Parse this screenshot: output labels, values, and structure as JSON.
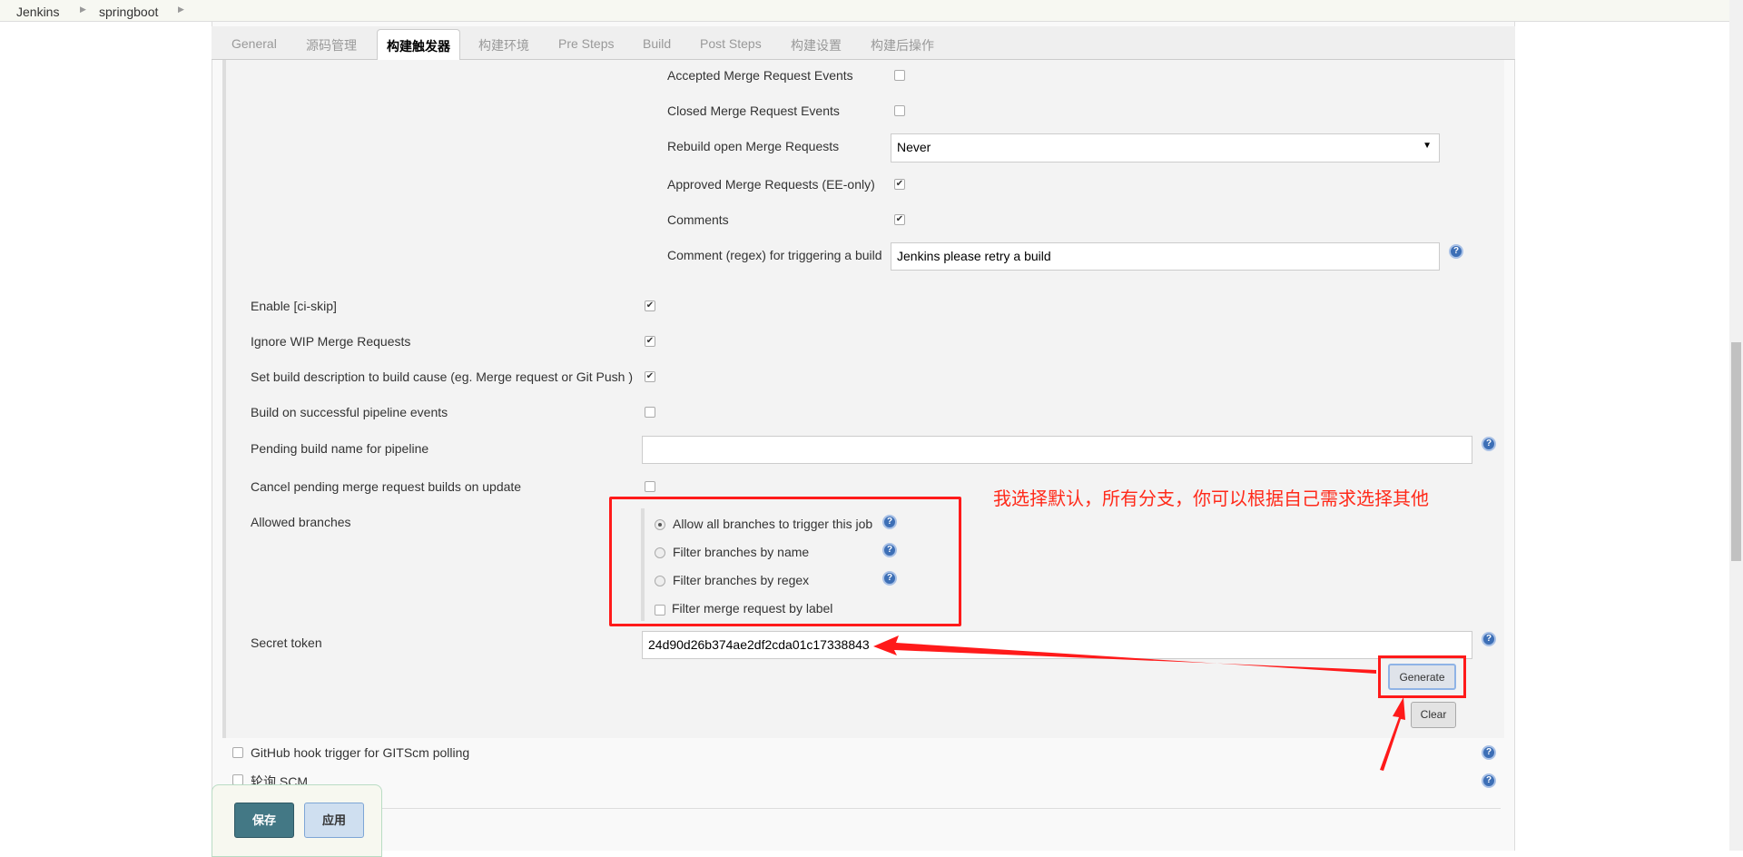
{
  "breadcrumb": [
    "Jenkins",
    "springboot"
  ],
  "tabs": [
    "General",
    "源码管理",
    "构建触发器",
    "构建环境",
    "Pre Steps",
    "Build",
    "Post Steps",
    "构建设置",
    "构建后操作"
  ],
  "active_tab": "构建触发器",
  "nested": {
    "accepted": {
      "label": "Accepted Merge Request Events",
      "checked": false
    },
    "closed": {
      "label": "Closed Merge Request Events",
      "checked": false
    },
    "rebuild": {
      "label": "Rebuild open Merge Requests",
      "value": "Never"
    },
    "approved": {
      "label": "Approved Merge Requests (EE-only)",
      "checked": true
    },
    "comments": {
      "label": "Comments",
      "checked": true
    },
    "comment_regex": {
      "label": "Comment (regex) for triggering a build",
      "value": "Jenkins please retry a build"
    }
  },
  "options": {
    "ci_skip": {
      "label": "Enable [ci-skip]",
      "checked": true
    },
    "wip": {
      "label": "Ignore WIP Merge Requests",
      "checked": true
    },
    "set_desc": {
      "label": "Set build description to build cause (eg. Merge request or Git Push )",
      "checked": true
    },
    "pipeline": {
      "label": "Build on successful pipeline events",
      "checked": false
    },
    "pending_name": {
      "label": "Pending build name for pipeline",
      "value": ""
    },
    "cancel_pending": {
      "label": "Cancel pending merge request builds on update",
      "checked": false
    },
    "allowed_branches": {
      "label": "Allowed branches",
      "radios": [
        "Allow all branches to trigger this job",
        "Filter branches by name",
        "Filter branches by regex"
      ],
      "selected": 0,
      "label_filter": "Filter merge request by label"
    },
    "secret": {
      "label": "Secret token",
      "value": "24d90d26b374ae2df2cda01c17338843",
      "generate": "Generate",
      "clear": "Clear"
    }
  },
  "annotation": "我选择默认，所有分支，你可以根据自己需求选择其他",
  "annotation_color": "#ff2a1a",
  "triggers": {
    "github": "GitHub hook trigger for GITScm polling",
    "poll": "轮询 SCM"
  },
  "footer": {
    "save": "保存",
    "apply": "应用"
  }
}
